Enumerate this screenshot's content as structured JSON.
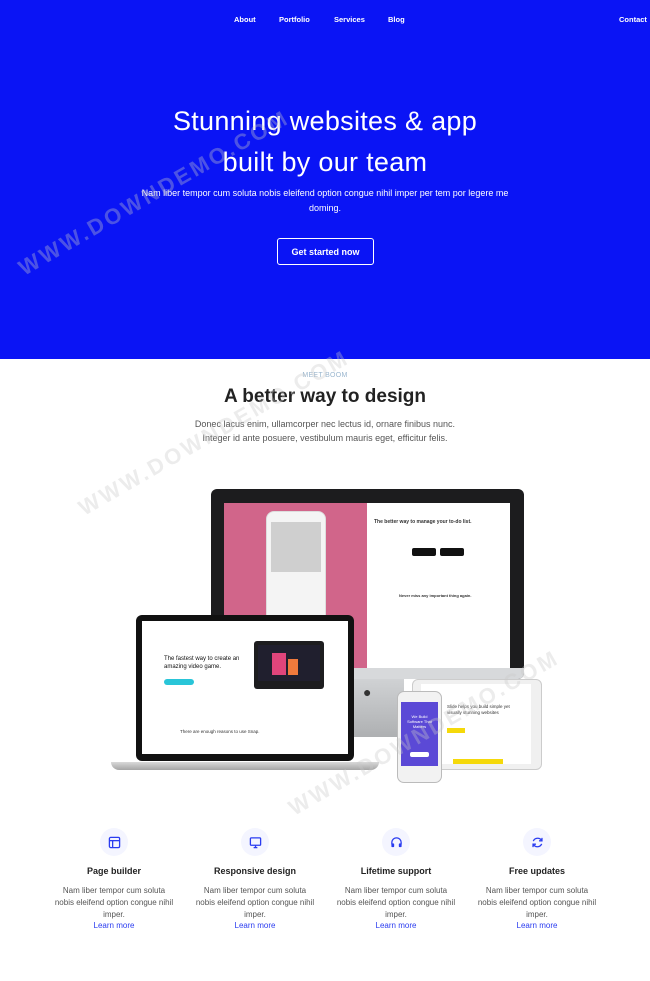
{
  "nav": {
    "items": [
      "About",
      "Portfolio",
      "Services",
      "Blog"
    ],
    "contact": "Contact"
  },
  "hero": {
    "title_line1": "Stunning websites & app",
    "title_line2": "built by our team",
    "subtitle": "Nam liber tempor cum soluta nobis eleifend option congue nihil imper per tem por legere me doming.",
    "cta": "Get started now",
    "background": "#0a14f5"
  },
  "intro": {
    "eyebrow": "MEET BOOM",
    "title": "A better way to design",
    "description": "Donec lacus enim, ullamcorper nec lectus id, ornare finibus nunc. Integer id ante posuere, vestibulum mauris eget, efficitur felis."
  },
  "devices": {
    "imac_heading": "The better way to manage your to-do list.",
    "imac_sub": "Never miss any important thing again.",
    "laptop_heading": "The fastest way to create an amazing video game.",
    "laptop_footer": "There are enough reasons to use Snap.",
    "tablet_heading": "Slide helps you build simple yet visually stunning websites",
    "phone_heading": "We Build Software That Matters"
  },
  "features": [
    {
      "icon": "layout-icon",
      "title": "Page builder",
      "text": "Nam liber tempor cum soluta nobis eleifend option congue nihil imper.",
      "link": "Learn more"
    },
    {
      "icon": "monitor-icon",
      "title": "Responsive design",
      "text": "Nam liber tempor cum soluta nobis eleifend option congue nihil imper.",
      "link": "Learn more"
    },
    {
      "icon": "headphones-icon",
      "title": "Lifetime support",
      "text": "Nam liber tempor cum soluta nobis eleifend option congue nihil imper.",
      "link": "Learn more"
    },
    {
      "icon": "refresh-icon",
      "title": "Free updates",
      "text": "Nam liber tempor cum soluta nobis eleifend option congue nihil imper.",
      "link": "Learn more"
    }
  ],
  "colors": {
    "accent": "#2a3cf0",
    "hero_bg": "#0a14f5",
    "imac_pink": "#d1658a",
    "phone_purple": "#5b49d6",
    "tablet_yellow": "#f5d90a"
  },
  "watermark": "WWW.DOWNDEMO.COM"
}
